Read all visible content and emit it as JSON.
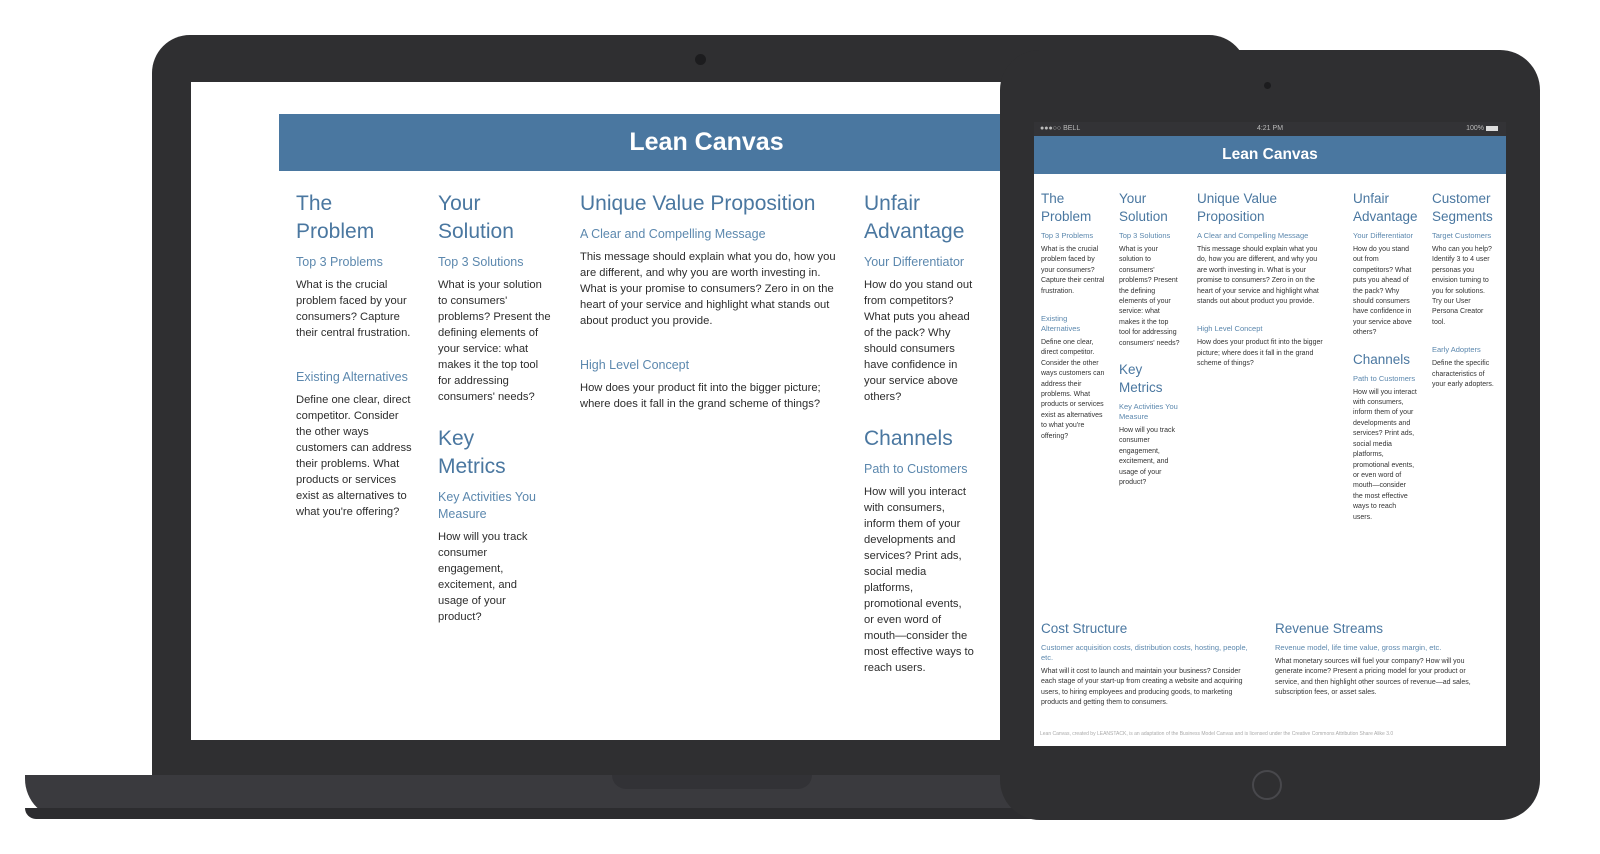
{
  "canvas_title": "Lean Canvas",
  "laptop": {
    "columns": [
      {
        "sections": [
          {
            "title": "The Problem",
            "subtitle": "Top 3 Problems",
            "body": "What is the crucial problem faced by your consumers? Capture their central frustration."
          },
          {
            "title": "",
            "subtitle": "Existing Alternatives",
            "body": "Define one clear, direct competitor. Consider the other ways customers can address their problems. What products or services exist as alternatives to what you're offering?"
          }
        ]
      },
      {
        "sections": [
          {
            "title": "Your Solution",
            "subtitle": "Top 3 Solutions",
            "body": "What is your solution to consumers' problems? Present the defining elements of your service: what makes it the top tool for addressing consumers' needs?"
          },
          {
            "title": "Key Metrics",
            "subtitle": "Key Activities You Measure",
            "body": "How will you track consumer engagement, excitement, and usage of your product?"
          }
        ]
      },
      {
        "sections": [
          {
            "title": "Unique Value Proposition",
            "subtitle": "A Clear and Compelling Message",
            "body": "This message should explain what you do, how you are different, and why you are worth investing in. What is your promise to consumers? Zero in on the heart of your service and highlight what stands out about product you provide."
          },
          {
            "title": "",
            "subtitle": "High Level Concept",
            "body": "How does your product fit into the bigger picture; where does it fall in the grand scheme of things?"
          }
        ]
      },
      {
        "sections": [
          {
            "title": "Unfair Advantage",
            "subtitle": "Your Differentiator",
            "body": "How do you stand out from competitors? What puts you ahead of the pack? Why should consumers have confidence in your service above others?"
          },
          {
            "title": "Channels",
            "subtitle": "Path to Customers",
            "body": "How will you interact with consumers, inform them of your developments and services? Print ads, social media platforms, promotional events, or even word of mouth—consider the most effective ways to reach users."
          }
        ]
      }
    ]
  },
  "tablet": {
    "status_bar": {
      "carrier": "●●●○○ BELL",
      "time": "4:21 PM",
      "battery": "100%"
    },
    "columns": [
      {
        "sections": [
          {
            "title": "The Problem",
            "subtitle": "Top 3 Problems",
            "body": "What is the crucial problem faced by your consumers? Capture their central frustration."
          },
          {
            "title": "",
            "subtitle": "Existing Alternatives",
            "body": "Define one clear, direct competitor. Consider the other ways customers can address their problems. What products or services exist as alternatives to what you're offering?"
          }
        ]
      },
      {
        "sections": [
          {
            "title": "Your Solution",
            "subtitle": "Top 3 Solutions",
            "body": "What is your solution to consumers' problems? Present the defining elements of your service: what makes it the top tool for addressing consumers' needs?"
          },
          {
            "title": "Key Metrics",
            "subtitle": "Key Activities You Measure",
            "body": "How will you track consumer engagement, excitement, and usage of your product?"
          }
        ]
      },
      {
        "sections": [
          {
            "title": "Unique Value Proposition",
            "subtitle": "A Clear and Compelling Message",
            "body": "This message should explain what you do, how you are different, and why you are worth investing in. What is your promise to consumers? Zero in on the heart of your service and highlight what stands out about product you provide."
          },
          {
            "title": "",
            "subtitle": "High Level Concept",
            "body": "How does your product fit into the bigger picture; where does it fall in the grand scheme of things?"
          }
        ]
      },
      {
        "sections": [
          {
            "title": "Unfair Advantage",
            "subtitle": "Your Differentiator",
            "body": "How do you stand out from competitors? What puts you ahead of the pack? Why should consumers have confidence in your service above others?"
          },
          {
            "title": "Channels",
            "subtitle": "Path to Customers",
            "body": "How will you interact with consumers, inform them of your developments and services? Print ads, social media platforms, promotional events, or even word of mouth—consider the most effective ways to reach users."
          }
        ]
      },
      {
        "sections": [
          {
            "title": "Customer Segments",
            "subtitle": "Target Customers",
            "body": "Who can you help? Identify 3 to 4 user personas you envision turning to you for solutions. Try our User Persona Creator tool."
          },
          {
            "title": "",
            "subtitle": "Early Adopters",
            "body": "Define the specific characteristics of your early adopters."
          }
        ]
      }
    ],
    "bottom": [
      {
        "title": "Cost Structure",
        "subtitle": "Customer acquisition costs, distribution costs, hosting, people, etc.",
        "body": "What will it cost to launch and maintain your business? Consider each stage of your start-up from creating a website and acquiring users, to hiring employees and producing goods, to marketing products and getting them to consumers."
      },
      {
        "title": "Revenue Streams",
        "subtitle": "Revenue model, life time value, gross margin, etc.",
        "body": "What monetary sources will fuel your company? How will you generate income? Present a pricing model for your product or service, and then highlight other sources of revenue—ad sales, subscription fees, or asset sales."
      }
    ],
    "footer": "Lean Canvas, created by LEANSTACK, is an adaptation of the Business Model Canvas and is licensed under the Creative Commons Attribution Share Alike 3.0"
  }
}
